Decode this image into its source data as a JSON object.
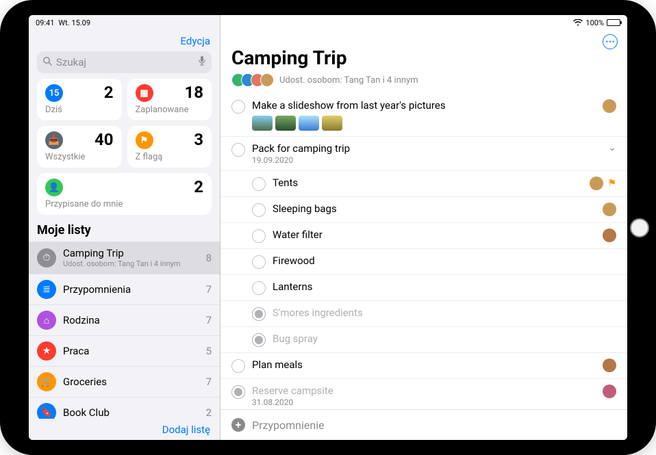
{
  "status": {
    "time": "09:41",
    "date": "Wt. 15.09",
    "battery_pct": "100%"
  },
  "sidebar": {
    "edit": "Edycja",
    "search_placeholder": "Szukaj",
    "cards": [
      {
        "label": "Dziś",
        "count": "2",
        "color": "#007aff",
        "glyph": "15"
      },
      {
        "label": "Zaplanowane",
        "count": "18",
        "color": "#ff3b30",
        "glyph": "▦"
      },
      {
        "label": "Wszystkie",
        "count": "40",
        "color": "#5b6770",
        "glyph": "📥"
      },
      {
        "label": "Z flagą",
        "count": "3",
        "color": "#ff9500",
        "glyph": "⚑"
      }
    ],
    "assigned": {
      "label": "Przypisane do mnie",
      "count": "2",
      "color": "#34c759",
      "glyph": "👤"
    },
    "my_lists_header": "Moje listy",
    "lists": [
      {
        "title": "Camping Trip",
        "subtitle": "Udost. osobom: Tang Tan i 4 innym",
        "count": "8",
        "color": "#8e8e93",
        "glyph": "⏱",
        "selected": true
      },
      {
        "title": "Przypomnienia",
        "count": "7",
        "color": "#007aff",
        "glyph": "≣"
      },
      {
        "title": "Rodzina",
        "count": "7",
        "color": "#af52de",
        "glyph": "⌂"
      },
      {
        "title": "Praca",
        "count": "5",
        "color": "#ff3b30",
        "glyph": "★"
      },
      {
        "title": "Groceries",
        "count": "7",
        "color": "#ff9500",
        "glyph": "🛒"
      },
      {
        "title": "Book Club",
        "count": "2",
        "color": "#007aff",
        "glyph": "🔖"
      }
    ],
    "add_list": "Dodaj listę"
  },
  "main": {
    "more_glyph": "⋯",
    "title": "Camping Trip",
    "shared_text": "Udost. osobom: Tang Tan i 4 innym",
    "shared_avatars": [
      "#38b26d",
      "#2a8bd6",
      "#e0775e",
      "#c99a57"
    ],
    "tasks": [
      {
        "title": "Make a slideshow from last year's pictures",
        "avatar": "#c99a57",
        "thumbs": 4
      },
      {
        "title": "Pack for camping trip",
        "date": "19.09.2020",
        "expand": true,
        "subtasks": [
          {
            "title": "Tents",
            "avatar": "#c99a57",
            "flag": true
          },
          {
            "title": "Sleeping bags",
            "avatar": "#c99a57"
          },
          {
            "title": "Water filter",
            "avatar": "#b47749"
          },
          {
            "title": "Firewood"
          },
          {
            "title": "Lanterns"
          },
          {
            "title": "S'mores ingredients",
            "done": true
          },
          {
            "title": "Bug spray",
            "done": true
          }
        ]
      },
      {
        "title": "Plan meals",
        "avatar": "#b47749"
      },
      {
        "title": "Reserve campsite",
        "date": "31.08.2020",
        "done": true,
        "avatar": "#c15c7a"
      }
    ],
    "new_reminder": "Przypomnienie"
  }
}
